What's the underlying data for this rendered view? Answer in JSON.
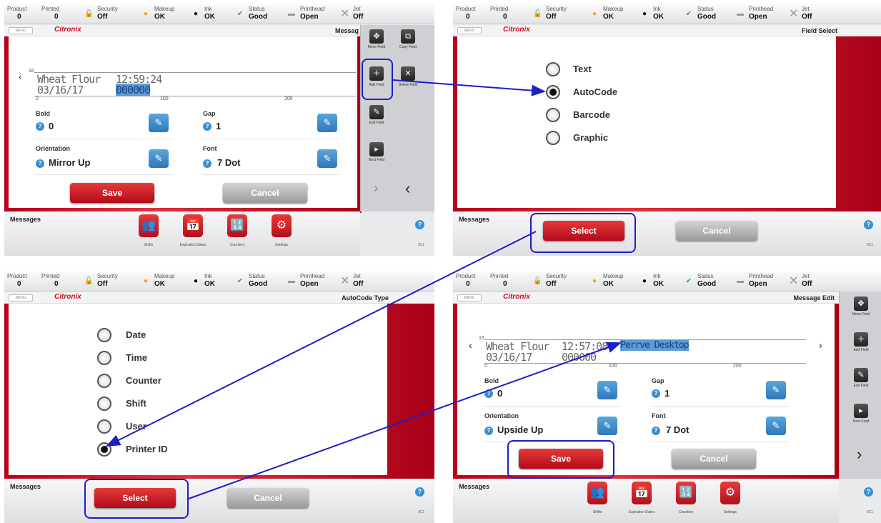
{
  "status": {
    "product": {
      "label": "Product",
      "value": "0"
    },
    "printed": {
      "label": "Printed",
      "value": "0"
    },
    "security": {
      "label": "Security",
      "value": "Off"
    },
    "makeup": {
      "label": "Makeup",
      "value": "OK"
    },
    "ink": {
      "label": "Ink",
      "value": "OK"
    },
    "status": {
      "label": "Status",
      "value": "Good"
    },
    "printhead": {
      "label": "Printhead",
      "value": "Open"
    },
    "jet": {
      "label": "Jet",
      "value": "Off"
    }
  },
  "menu_label": "MENU",
  "logo": "Citronix",
  "panel1": {
    "title": "Messag",
    "preview": {
      "line1": "Wheat Flour",
      "time": "12:59:24",
      "line2": "03/16/17",
      "code": "000000",
      "size": "16",
      "r0": "0",
      "r100": "100",
      "r200": "200"
    },
    "params": {
      "bold_label": "Bold",
      "bold_value": "0",
      "gap_label": "Gap",
      "gap_value": "1",
      "orient_label": "Orientation",
      "orient_value": "Mirror Up",
      "font_label": "Font",
      "font_value": "7 Dot"
    },
    "save": "Save",
    "cancel": "Cancel",
    "side": {
      "move": "Move Field",
      "copy": "Copy Field",
      "add": "Add Field",
      "delete": "Delete Field",
      "edit": "Edit Field",
      "next": "Next Field"
    }
  },
  "panel2": {
    "title": "Field Select",
    "options": [
      "Text",
      "AutoCode",
      "Barcode",
      "Graphic"
    ],
    "selected": "AutoCode",
    "select": "Select",
    "cancel": "Cancel"
  },
  "panel3": {
    "title": "AutoCode Type",
    "options": [
      "Date",
      "Time",
      "Counter",
      "Shift",
      "User",
      "Printer ID"
    ],
    "selected": "Printer ID",
    "select": "Select",
    "cancel": "Cancel"
  },
  "panel4": {
    "title": "Message Edit",
    "preview": {
      "line1": "Wheat Flour",
      "time": "12:57:08",
      "printer": "Perrve Desktop",
      "line2": "03/16/17",
      "code": "000000",
      "size": "16",
      "r0": "0",
      "r100": "100",
      "r200": "200"
    },
    "params": {
      "bold_label": "Bold",
      "bold_value": "0",
      "gap_label": "Gap",
      "gap_value": "1",
      "orient_label": "Orientation",
      "orient_value": "Upside Up",
      "font_label": "Font",
      "font_value": "7 Dot"
    },
    "save": "Save",
    "cancel": "Cancel",
    "side": {
      "move": "Move Field",
      "add": "Add Field",
      "edit": "Edit Field",
      "next": "Next Field"
    }
  },
  "footer": {
    "messages": "Messages",
    "shifts": "Shifts",
    "expiration": "Expiration Dates",
    "counters": "Counters",
    "settings": "Settings",
    "version": "9C1"
  },
  "colors": {
    "accent_red": "#c8102e",
    "highlight_blue": "#1e1ec8",
    "help_blue": "#3a8fd3"
  }
}
